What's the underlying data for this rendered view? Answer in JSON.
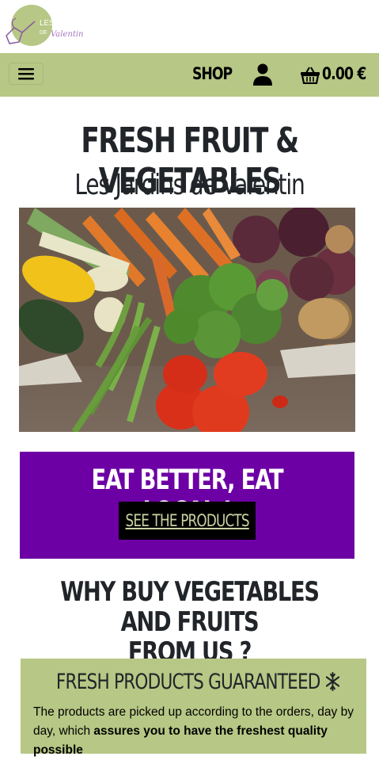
{
  "logo": {
    "text_line1": "LES JARDINS",
    "text_line2": "DE",
    "script_text": "Valentin",
    "icon": "watering-can-logo"
  },
  "nav": {
    "menu_icon": "hamburger-icon",
    "shop_label": "SHOP",
    "account_icon": "user-icon",
    "cart_icon": "basket-icon",
    "cart_total": "0.00 €"
  },
  "hero": {
    "title": "FRESH FRUIT & VEGETABLES",
    "subtitle": "Les Jardins de Valentin",
    "image": "vegetables-photo"
  },
  "promo": {
    "title": "EAT BETTER, EAT LOCAL !",
    "button_label": "SEE THE PRODUCTS",
    "background": "#6d00a4",
    "button_text_color": "#c8d3a1"
  },
  "why": {
    "line1": "WHY BUY VEGETABLES AND FRUITS",
    "line2": "FROM US ?"
  },
  "features": [
    {
      "title": "FRESH PRODUCTS GUARANTEED",
      "icon": "snowflake-icon",
      "text_plain": "The products are picked up according to the orders, day by day, which ",
      "text_bold": "assures you to have the freshest quality possible"
    }
  ],
  "colors": {
    "accent_green": "#b7c785",
    "purple": "#6d00a4",
    "text_dark": "#212529"
  }
}
